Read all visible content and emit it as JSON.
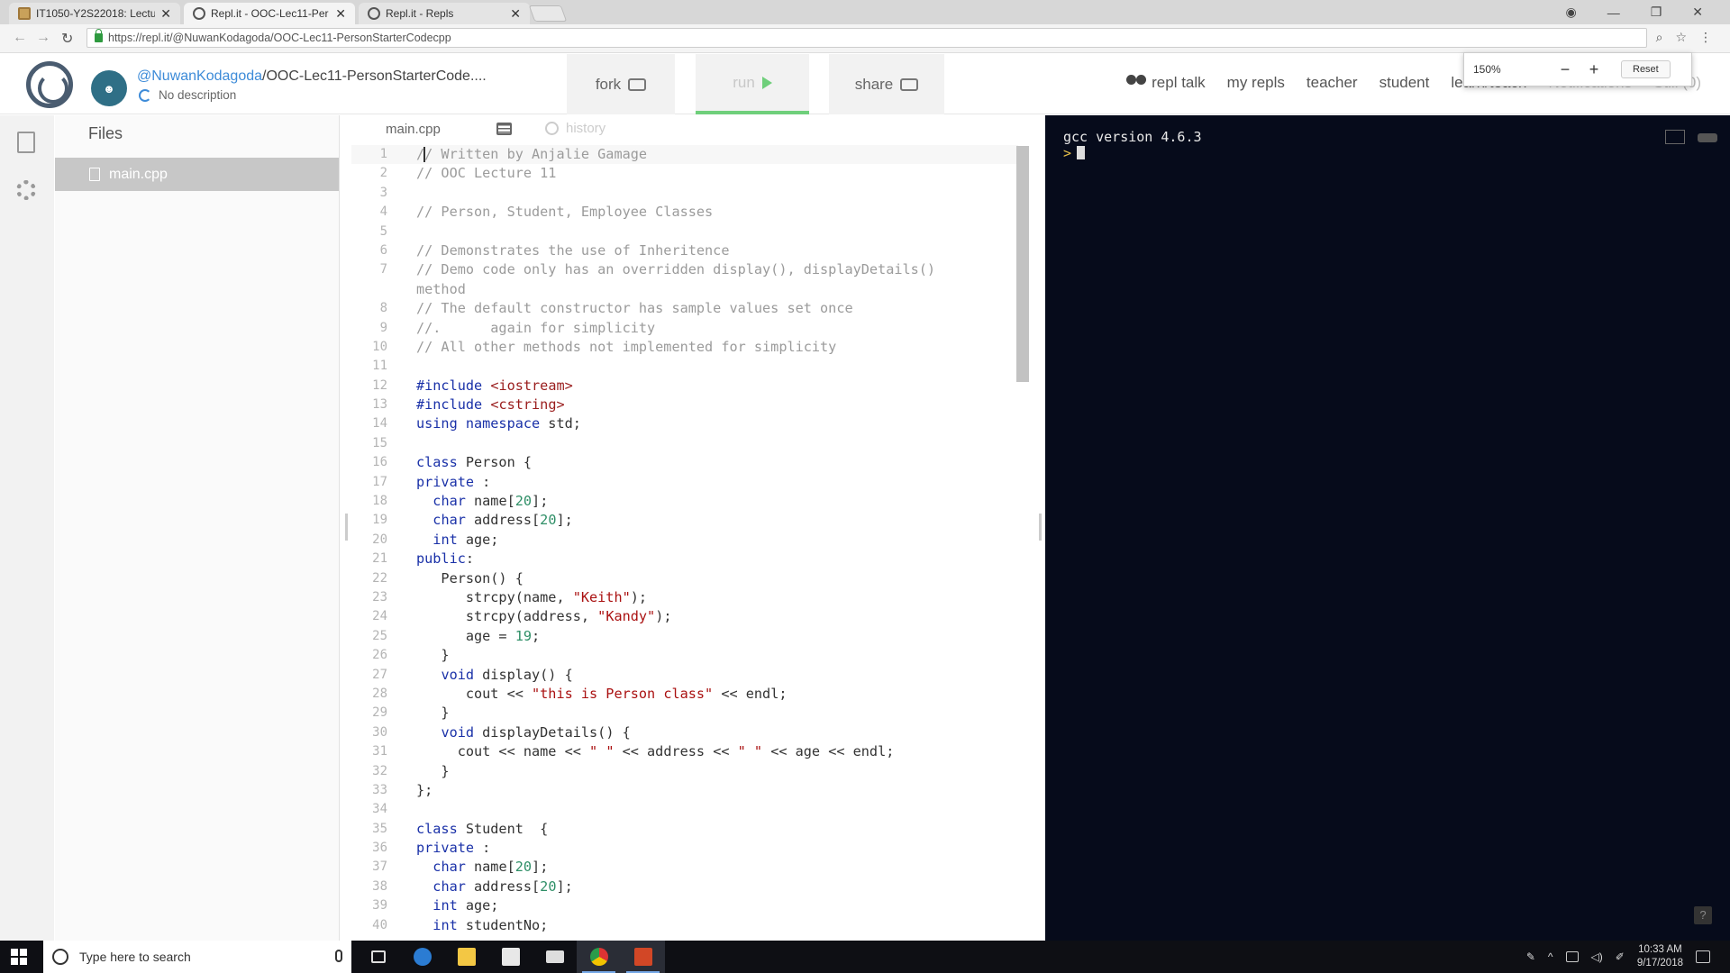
{
  "browser": {
    "tabs": [
      {
        "title": "IT1050-Y2S22018: Lectu",
        "active": false
      },
      {
        "title": "Repl.it - OOC-Lec11-Per",
        "active": true
      },
      {
        "title": "Repl.it - Repls",
        "active": false
      }
    ],
    "url": "https://repl.it/@NuwanKodagoda/OOC-Lec11-PersonStarterCodecpp",
    "zoom": {
      "percent": "150%",
      "minus": "−",
      "plus": "+",
      "reset": "Reset"
    }
  },
  "header": {
    "user": "@NuwanKodagoda",
    "repl_name": "OOC-Lec11-PersonStarterCode....",
    "description": "No description",
    "fork": "fork",
    "run": "run",
    "share": "share",
    "nav": [
      "repl talk",
      "my repls",
      "teacher",
      "student",
      "learn/teach",
      "Notifications",
      "Still (0)"
    ]
  },
  "files": {
    "title": "Files",
    "items": [
      {
        "name": "main.cpp"
      }
    ]
  },
  "editor": {
    "tab": "main.cpp",
    "history": "history"
  },
  "console": {
    "lines": [
      "gcc version 4.6.3"
    ],
    "prompt": ">"
  },
  "taskbar": {
    "search_placeholder": "Type here to search",
    "time": "10:33 AM",
    "date": "9/17/2018"
  },
  "colors": {
    "run_accent": "#6fcf7b",
    "link_blue": "#3d8bd8",
    "console_bg": "#060b1b"
  }
}
